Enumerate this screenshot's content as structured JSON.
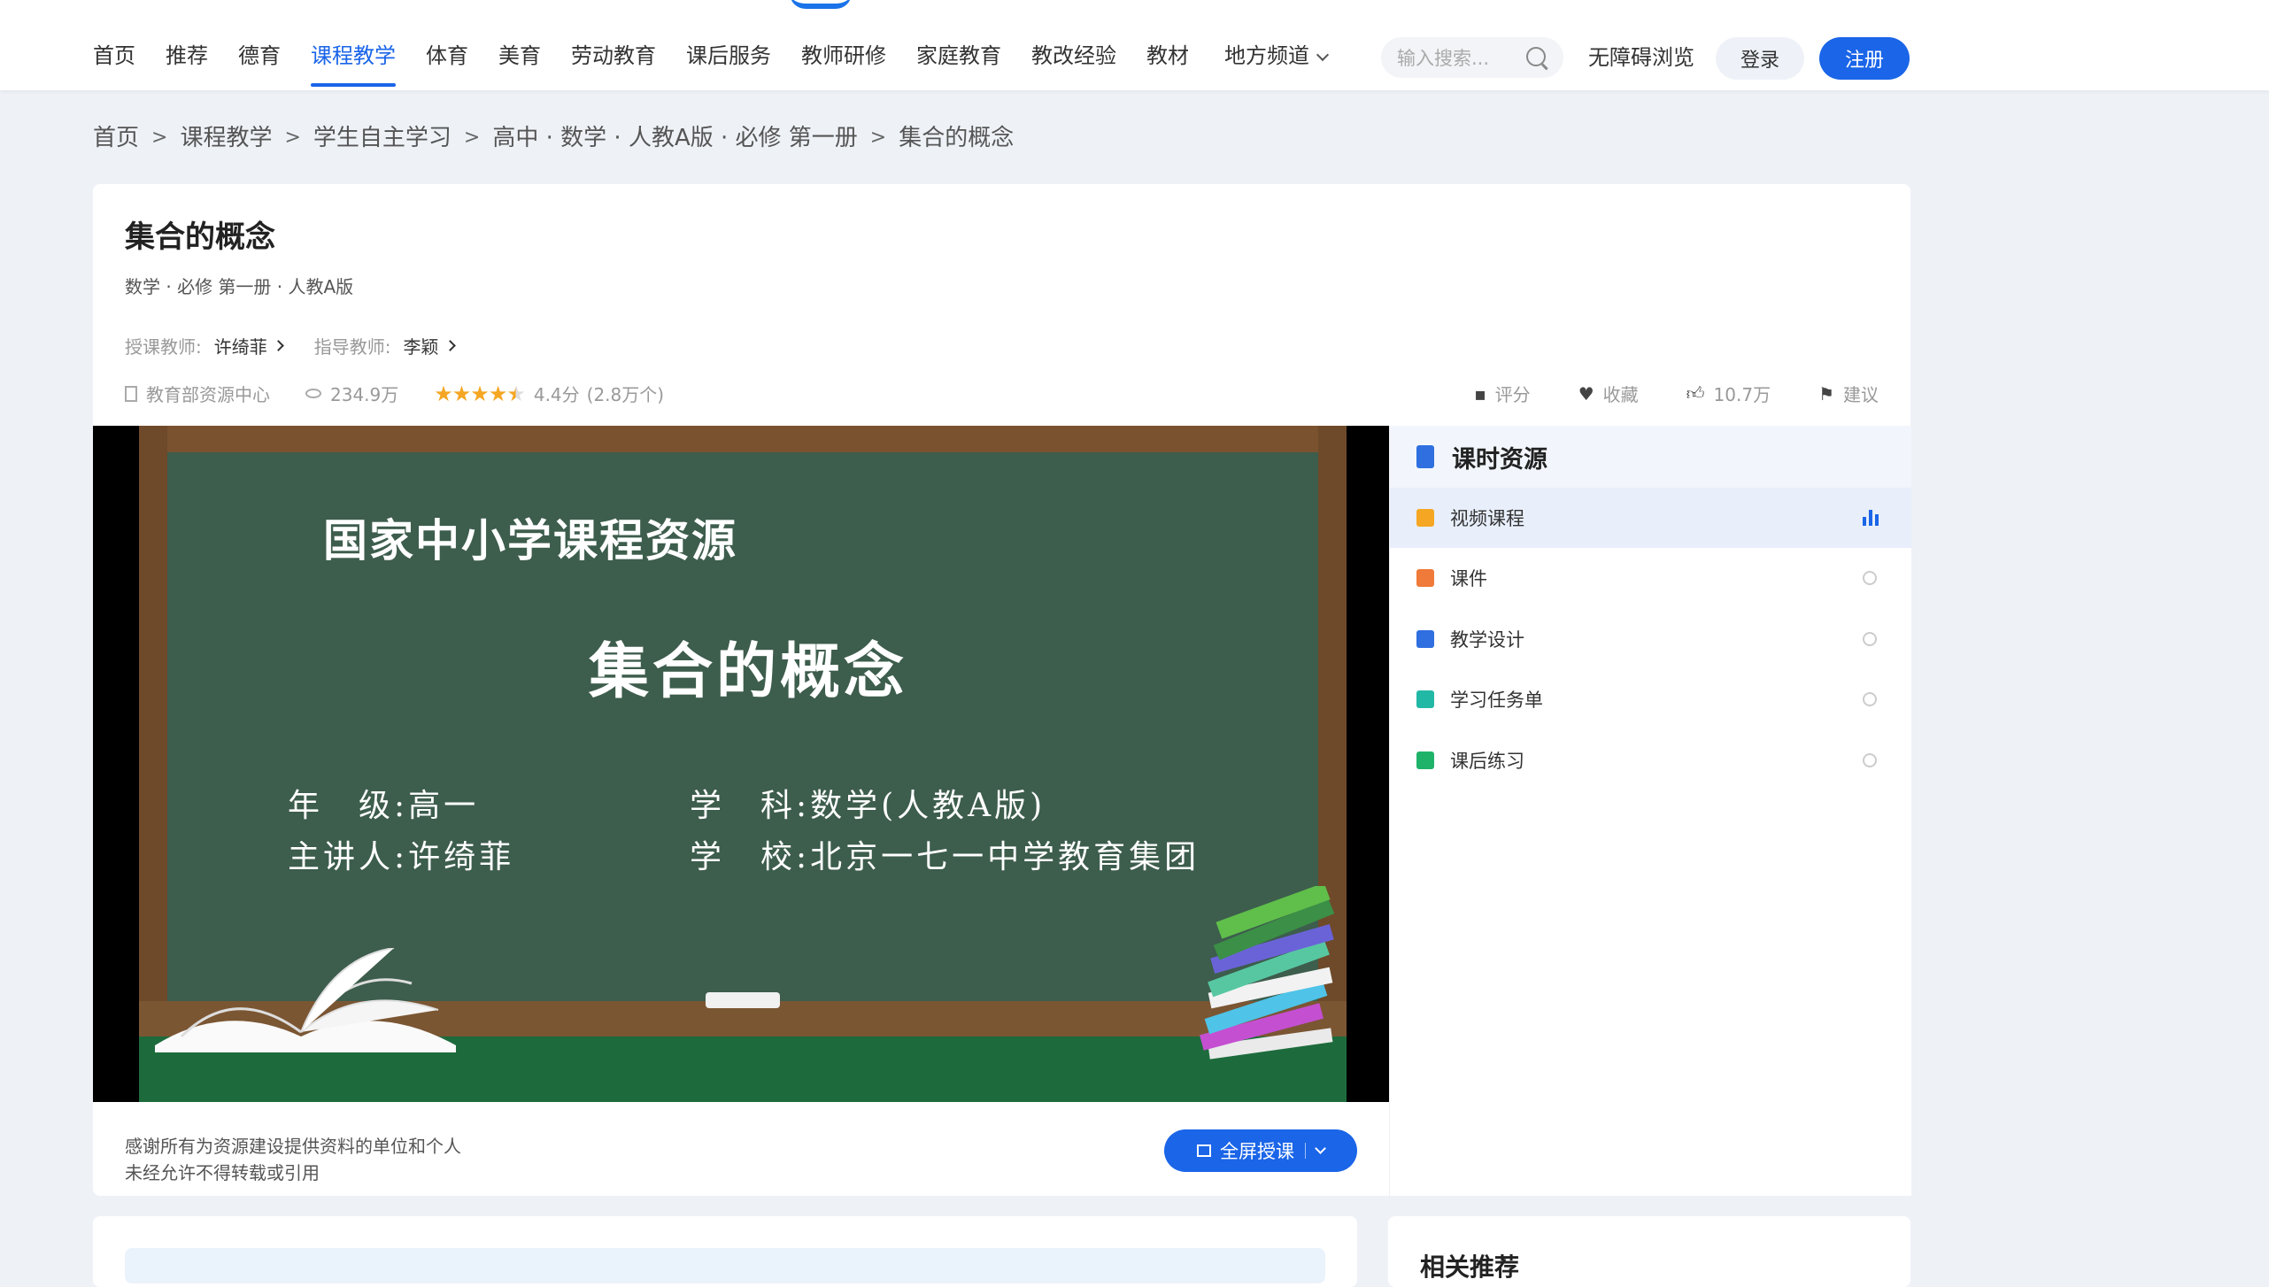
{
  "nav": {
    "items": [
      "首页",
      "推荐",
      "德育",
      "课程教学",
      "体育",
      "美育",
      "劳动教育",
      "课后服务",
      "教师研修",
      "家庭教育",
      "教改经验",
      "教材",
      "地方频道"
    ],
    "active_index": 3,
    "search_placeholder": "输入搜索...",
    "accessibility": "无障碍浏览",
    "login": "登录",
    "register": "注册"
  },
  "breadcrumb": [
    "首页",
    "课程教学",
    "学生自主学习",
    "高中 · 数学 · 人教A版 · 必修 第一册",
    "集合的概念"
  ],
  "breadcrumb_sep": ">",
  "lesson": {
    "title": "集合的概念",
    "subtitle": "数学 · 必修 第一册 · 人教A版",
    "teacher_label": "授课教师:",
    "teacher": "许绮菲",
    "advisor_label": "指导教师:",
    "advisor": "李颖",
    "source": "教育部资源中心",
    "views": "234.9万",
    "rating_stars": 4.4,
    "rating_text": "4.4分",
    "rating_count": "(2.8万个)",
    "actions": {
      "rate": "评分",
      "favorite": "收藏",
      "likes": "10.7万",
      "suggest": "建议"
    }
  },
  "video": {
    "heading": "国家中小学课程资源",
    "lesson_title": "集合的概念",
    "grade_label": "年　级:",
    "grade": "高一",
    "subject_label": "学　科:",
    "subject": "数学(人教A版)",
    "speaker_label": "主讲人:",
    "speaker": "许绮菲",
    "school_label": "学　校:",
    "school": "北京一七一中学教育集团"
  },
  "notice": {
    "line1": "感谢所有为资源建设提供资料的单位和个人",
    "line2": "未经允许不得转载或引用"
  },
  "fullscreen_button": "全屏授课",
  "sidebar": {
    "title": "课时资源",
    "items": [
      {
        "label": "视频课程",
        "icon": "video-icon",
        "color": "#f5a623",
        "active": true
      },
      {
        "label": "课件",
        "icon": "slides-icon",
        "color": "#f07a3a",
        "active": false
      },
      {
        "label": "教学设计",
        "icon": "design-icon",
        "color": "#2f6fe0",
        "active": false
      },
      {
        "label": "学习任务单",
        "icon": "clipboard-icon",
        "color": "#22b8a6",
        "active": false
      },
      {
        "label": "课后练习",
        "icon": "exercise-icon",
        "color": "#1fb36a",
        "active": false
      }
    ]
  },
  "related_title": "相关推荐",
  "colors": {
    "accent": "#1a65e8",
    "star": "#f5a623"
  }
}
